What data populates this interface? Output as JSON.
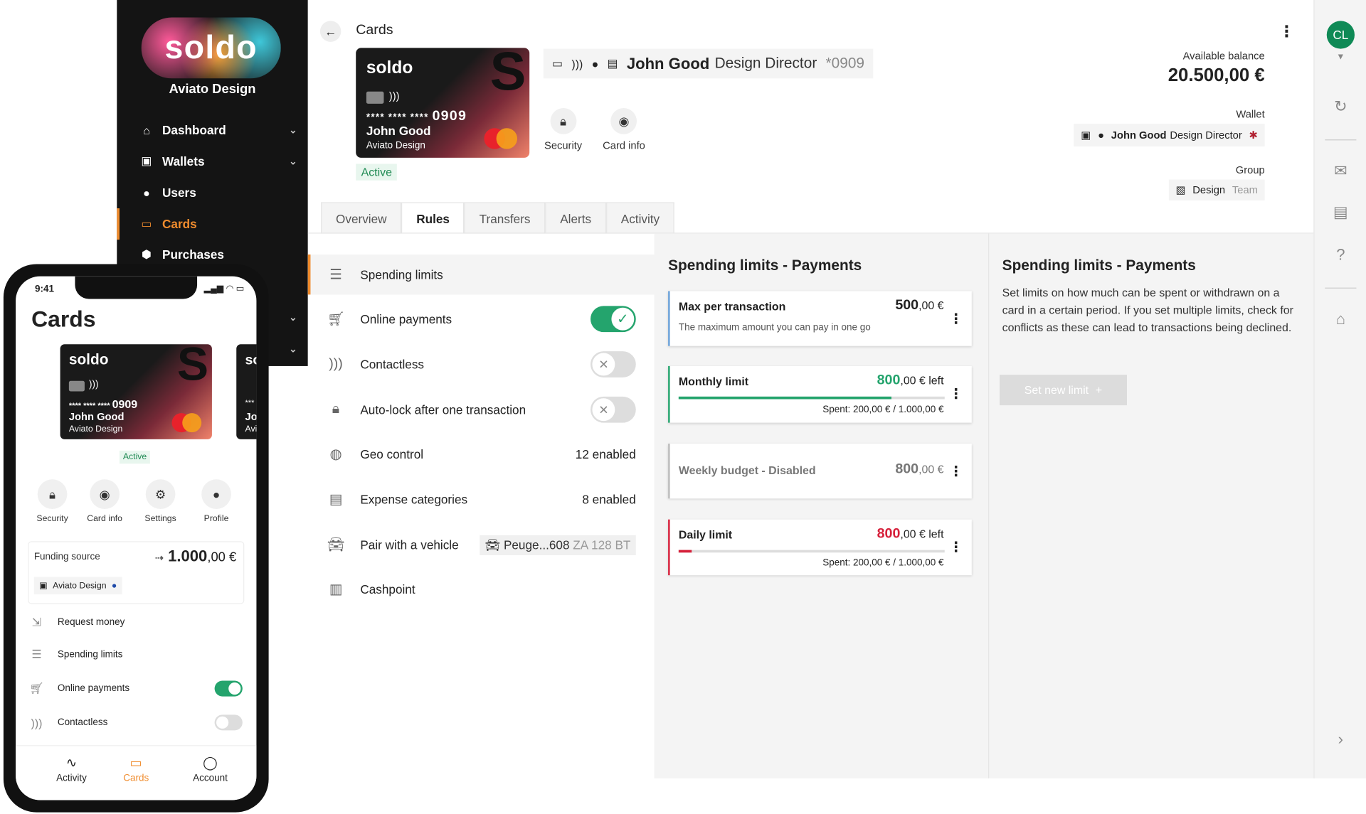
{
  "sidebar": {
    "logo": "soldo",
    "company": "Aviato Design",
    "items": [
      {
        "label": "Dashboard",
        "icon": "home-icon"
      },
      {
        "label": "Wallets",
        "icon": "wallet-icon"
      },
      {
        "label": "Users",
        "icon": "user-icon"
      },
      {
        "label": "Cards",
        "icon": "card-icon"
      },
      {
        "label": "Purchases",
        "icon": "purchases-icon"
      }
    ]
  },
  "header": {
    "breadcrumb": "Cards",
    "card": {
      "brand": "soldo",
      "number_mask": "**** **** ****",
      "last4": "0909",
      "holder": "John Good",
      "company": "Aviato Design"
    },
    "status": "Active",
    "card_title": {
      "name": "John Good",
      "role": "Design Director",
      "mask": "*0909"
    },
    "actions": [
      {
        "label": "Security"
      },
      {
        "label": "Card info"
      }
    ],
    "balance_label": "Available balance",
    "balance": "20.500,00 €",
    "wallet_label": "Wallet",
    "wallet_name": "John Good",
    "wallet_role": "Design Director",
    "group_label": "Group",
    "group_name": "Design",
    "group_type": "Team"
  },
  "tabs": [
    "Overview",
    "Rules",
    "Transfers",
    "Alerts",
    "Activity"
  ],
  "rules": {
    "spending_limits": "Spending limits",
    "online_payments": "Online payments",
    "contactless": "Contactless",
    "autolock": "Auto-lock after one transaction",
    "geo": "Geo control",
    "geo_value": "12 enabled",
    "expense": "Expense categories",
    "expense_value": "8 enabled",
    "vehicle": "Pair with a vehicle",
    "vehicle_name": "Peuge...608",
    "vehicle_plate": "ZA 128 BT",
    "cashpoint": "Cashpoint"
  },
  "limits": {
    "title": "Spending limits - Payments",
    "max": {
      "title": "Max per transaction",
      "amount_int": "500",
      "amount_dec": ",00 €",
      "desc": "The maximum amount you can pay in one go"
    },
    "monthly": {
      "title": "Monthly limit",
      "amount_int": "800",
      "amount_dec": ",00 € left",
      "spent": "Spent: 200,00 € / 1.000,00 €",
      "progress": 0.8,
      "color": "#24a46d"
    },
    "weekly": {
      "title": "Weekly budget - Disabled",
      "amount_int": "800",
      "amount_dec": ",00 €"
    },
    "daily": {
      "title": "Daily limit",
      "amount_int": "800",
      "amount_dec": ",00 € left",
      "spent": "Spent: 200,00 € / 1.000,00 €",
      "progress": 0.05,
      "color": "#d6203a"
    }
  },
  "help": {
    "title": "Spending limits - Payments",
    "text": "Set limits on how much can be spent or withdrawn on a card in a certain period. If you set multiple limits, check for conflicts as these can lead to transactions being declined.",
    "button": "Set new limit"
  },
  "rail": {
    "avatar": "CL"
  },
  "phone": {
    "time": "9:41",
    "title": "Cards",
    "card": {
      "brand": "soldo",
      "number_mask": "**** **** ****",
      "last4": "0909",
      "holder": "John Good",
      "company": "Aviato Design"
    },
    "card2": {
      "brand": "so",
      "mask": "***",
      "holder": "Jo",
      "company": "Avi"
    },
    "status": "Active",
    "actions": [
      "Security",
      "Card info",
      "Settings",
      "Profile"
    ],
    "funding_label": "Funding source",
    "funding_int": "1.000",
    "funding_dec": ",00 €",
    "funding_wallet": "Aviato Design",
    "rows": [
      "Request money",
      "Spending limits",
      "Online payments",
      "Contactless"
    ],
    "nav": [
      "Activity",
      "Cards",
      "Account"
    ]
  },
  "colors": {
    "accent": "#f08c2e",
    "success": "#24a46d",
    "danger": "#d6203a",
    "avatar": "#0f8a56"
  }
}
